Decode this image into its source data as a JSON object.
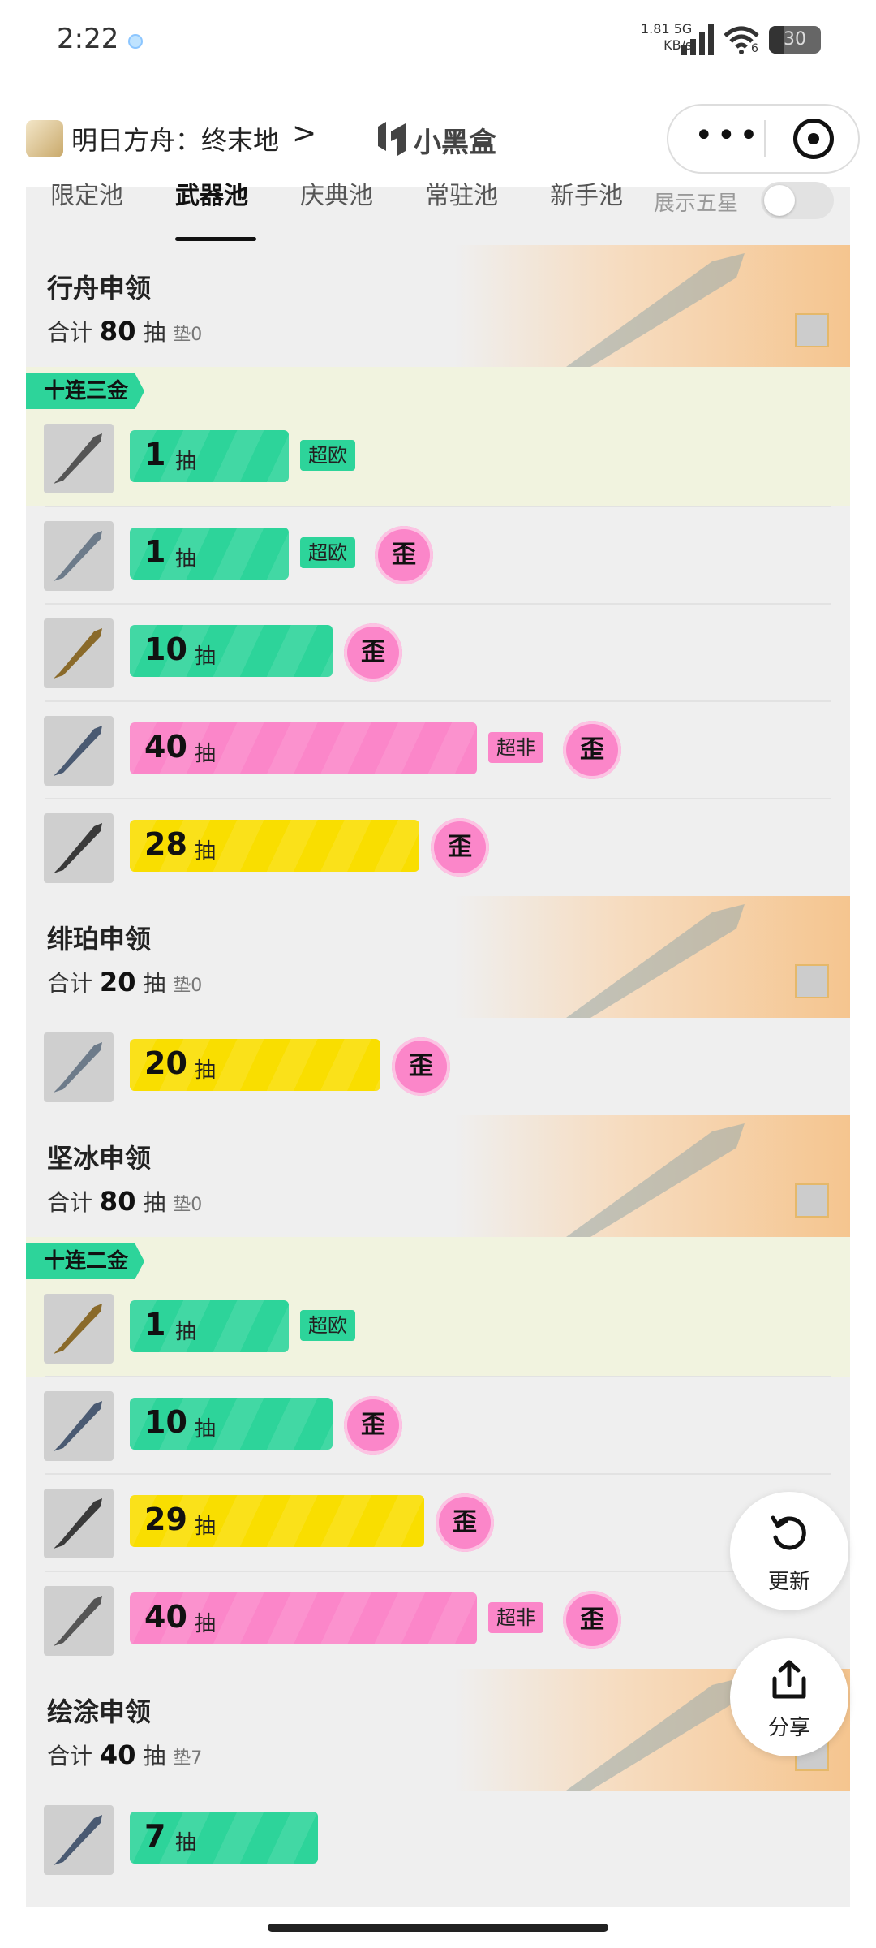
{
  "status_bar": {
    "time": "2:22",
    "net_speed_top": "1.81",
    "net_speed_unit": "KB/s",
    "net_type": "5G",
    "wifi_sub": "6",
    "battery": "30"
  },
  "header": {
    "app_title": "明日方舟：终末地",
    "chevron": ">",
    "brand": "小黑盒",
    "capsule_more": "•••"
  },
  "tabs": [
    {
      "label": "限定池"
    },
    {
      "label": "武器池",
      "active": true
    },
    {
      "label": "庆典池"
    },
    {
      "label": "常驻池"
    },
    {
      "label": "新手池"
    }
  ],
  "toggle": {
    "label": "展示五星",
    "on": false
  },
  "unit": "抽",
  "total_prefix": "合计",
  "pad_prefix": "垫",
  "wai_label": "歪",
  "pools": [
    {
      "name": "行舟申领",
      "total": "80",
      "pad": "0",
      "badge": "十连三金",
      "rows": [
        {
          "count": "1",
          "color": "green",
          "tag": "超欧",
          "wai": false
        },
        {
          "count": "1",
          "color": "green",
          "tag": "超欧",
          "wai": true
        },
        {
          "count": "10",
          "color": "green",
          "tag": "",
          "wai": true
        },
        {
          "count": "40",
          "color": "pink",
          "tag": "超非",
          "wai": true
        },
        {
          "count": "28",
          "color": "yellow",
          "tag": "",
          "wai": true
        }
      ]
    },
    {
      "name": "绯珀申领",
      "total": "20",
      "pad": "0",
      "badge": "",
      "rows": [
        {
          "count": "20",
          "color": "yellow",
          "tag": "",
          "wai": true
        }
      ]
    },
    {
      "name": "坚冰申领",
      "total": "80",
      "pad": "0",
      "badge": "十连二金",
      "rows": [
        {
          "count": "1",
          "color": "green",
          "tag": "超欧",
          "wai": false
        },
        {
          "count": "10",
          "color": "green",
          "tag": "",
          "wai": true
        },
        {
          "count": "29",
          "color": "yellow",
          "tag": "",
          "wai": true
        },
        {
          "count": "40",
          "color": "pink",
          "tag": "超非",
          "wai": true
        }
      ]
    },
    {
      "name": "绘涂申领",
      "total": "40",
      "pad": "7",
      "badge": "",
      "rows": [
        {
          "count": "7",
          "color": "green",
          "tag": "",
          "wai": false
        }
      ]
    }
  ],
  "fab_refresh": {
    "label": "更新",
    "icon": "refresh-icon"
  },
  "fab_share": {
    "label": "分享",
    "icon": "share-icon"
  },
  "colors": {
    "green": "#2dd49a",
    "pink": "#fb86c9",
    "yellow": "#f9de00"
  }
}
